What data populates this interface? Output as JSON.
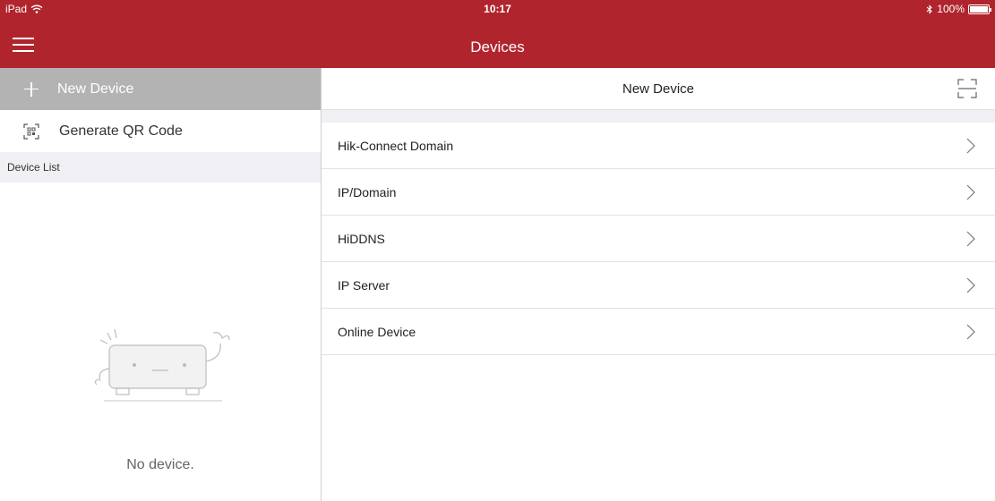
{
  "status_bar": {
    "device": "iPad",
    "time": "10:17",
    "battery_text": "100%"
  },
  "nav": {
    "title": "Devices"
  },
  "left_panel": {
    "new_device_label": "New Device",
    "generate_qr_label": "Generate QR Code",
    "device_list_header": "Device List",
    "empty_text": "No device."
  },
  "right_panel": {
    "title": "New Device",
    "options": [
      {
        "label": "Hik-Connect Domain"
      },
      {
        "label": "IP/Domain"
      },
      {
        "label": "HiDDNS"
      },
      {
        "label": "IP Server"
      },
      {
        "label": "Online Device"
      }
    ]
  },
  "colors": {
    "brand": "#b0252d",
    "disabled_bar": "#b3b3b3"
  },
  "icons": [
    "wifi-icon",
    "bluetooth-icon",
    "battery-icon",
    "menu-icon",
    "plus-icon",
    "qr-code-icon",
    "scan-icon",
    "chevron-right-icon",
    "empty-device-illustration"
  ]
}
